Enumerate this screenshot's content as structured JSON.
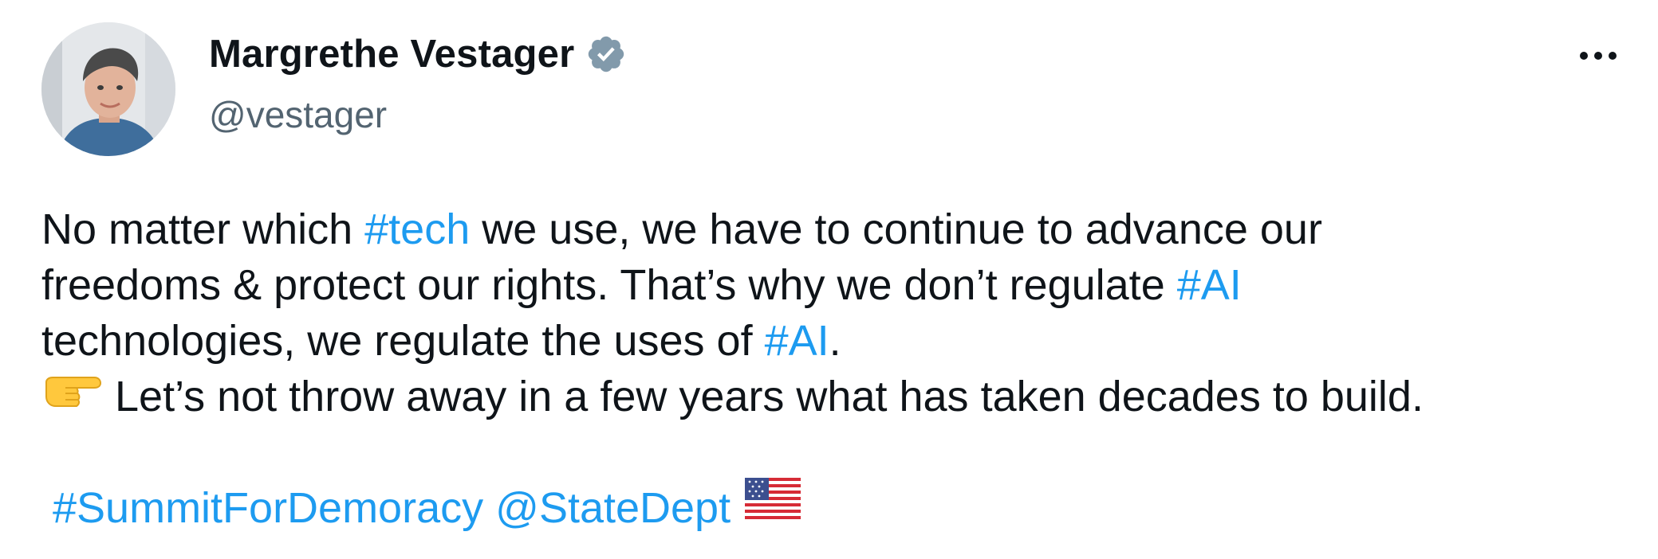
{
  "author": {
    "display_name": "Margrethe Vestager",
    "handle": "@vestager",
    "verified": true
  },
  "tweet": {
    "line1_pre": "No matter which ",
    "line1_tag": "#tech",
    "line1_post": " we use, we have to continue to advance our",
    "line2_pre": "freedoms & protect our rights. That’s why we don’t regulate ",
    "line2_tag": "#AI",
    "line3_pre": "technologies, we regulate the uses of ",
    "line3_tag": "#AI",
    "line3_post": ".",
    "line4_emoji": "backhand-index-pointing-right",
    "line4_text": "Let’s not throw away in a few years what has taken decades to build.",
    "hashtag_summit": "#SummitForDemoracy",
    "mention": "@StateDept",
    "flag_emoji": "us-flag"
  },
  "colors": {
    "link": "#1d9bf0",
    "text": "#0f1419",
    "secondary": "#536471",
    "verified_badge": "#829aab"
  },
  "icons": {
    "more": "more-horizontal-icon",
    "verified": "verified-badge-icon"
  }
}
